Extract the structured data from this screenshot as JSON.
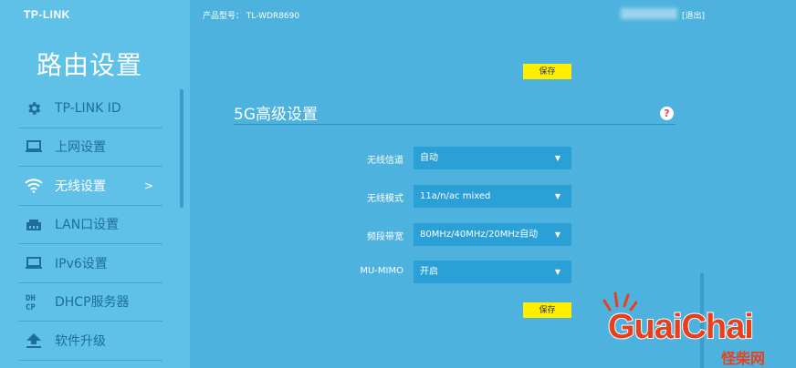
{
  "brand": "TP-LINK",
  "sidebar": {
    "title": "路由设置",
    "items": [
      {
        "label": "TP-LINK ID",
        "icon": "gear-icon",
        "active": false
      },
      {
        "label": "上网设置",
        "icon": "laptop-icon",
        "active": false
      },
      {
        "label": "无线设置",
        "icon": "wifi-icon",
        "active": true,
        "chevron": ">"
      },
      {
        "label": "LAN口设置",
        "icon": "lan-port-icon",
        "active": false
      },
      {
        "label": "IPv6设置",
        "icon": "laptop-icon",
        "active": false
      },
      {
        "label": "DHCP服务器",
        "icon": "dhcp-icon",
        "active": false
      },
      {
        "label": "软件升级",
        "icon": "upload-icon",
        "active": false
      }
    ]
  },
  "header": {
    "model_label": "产品型号：",
    "model": "TL-WDR8690",
    "logout": "[退出]"
  },
  "main": {
    "save_label": "保存",
    "section_title": "5G高级设置",
    "help": "?",
    "fields": [
      {
        "label": "无线信道",
        "value": "自动"
      },
      {
        "label": "无线模式",
        "value": "11a/n/ac mixed"
      },
      {
        "label": "频段带宽",
        "value": "80MHz/40MHz/20MHz自动"
      },
      {
        "label": "MU-MIMO",
        "value": "开启"
      }
    ]
  },
  "watermark": {
    "text": "GuaiChai",
    "sub": "怪柴网"
  },
  "colors": {
    "sidebar_bg": "#5fc1e8",
    "main_bg": "#4db3de",
    "select_bg": "#2aa0d6",
    "save_bg": "#ffee00",
    "icon_blue": "#1e6e99",
    "watermark": "#e8401d"
  }
}
